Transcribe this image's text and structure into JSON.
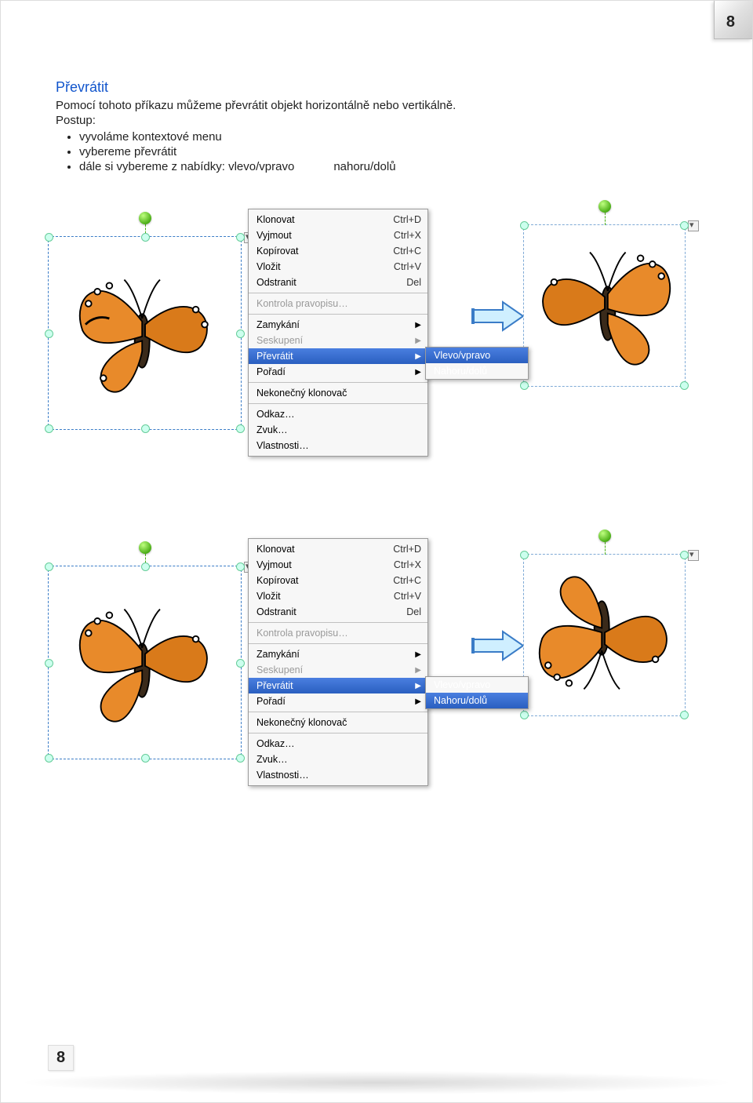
{
  "page_number_top": "8",
  "page_number_bottom": "8",
  "title": "Převrátit",
  "intro_line": "Pomocí tohoto příkazu můžeme převrátit objekt horizontálně nebo vertikálně.",
  "postup_label": "Postup:",
  "steps": {
    "s1": "vyvoláme kontextové menu",
    "s2": "vybereme převrátit",
    "s3a": "dále si vybereme z nabídky: vlevo/vpravo",
    "s3b": "nahoru/dolů"
  },
  "ctx": {
    "klonovat": "Klonovat",
    "klonovat_sc": "Ctrl+D",
    "vyjmout": "Vyjmout",
    "vyjmout_sc": "Ctrl+X",
    "kopirovat": "Kopírovat",
    "kopirovat_sc": "Ctrl+C",
    "vlozit": "Vložit",
    "vlozit_sc": "Ctrl+V",
    "odstranit": "Odstranit",
    "odstranit_sc": "Del",
    "kontrola": "Kontrola pravopisu…",
    "zamykani": "Zamykání",
    "seskupeni": "Seskupení",
    "prevratit": "Převrátit",
    "poradi": "Pořadí",
    "klonovac": "Nekonečný klonovač",
    "odkaz": "Odkaz…",
    "zvuk": "Zvuk…",
    "vlastnosti": "Vlastnosti…"
  },
  "submenu": {
    "vlevo": "Vlevo/vpravo",
    "nahoru": "Nahoru/dolů"
  }
}
